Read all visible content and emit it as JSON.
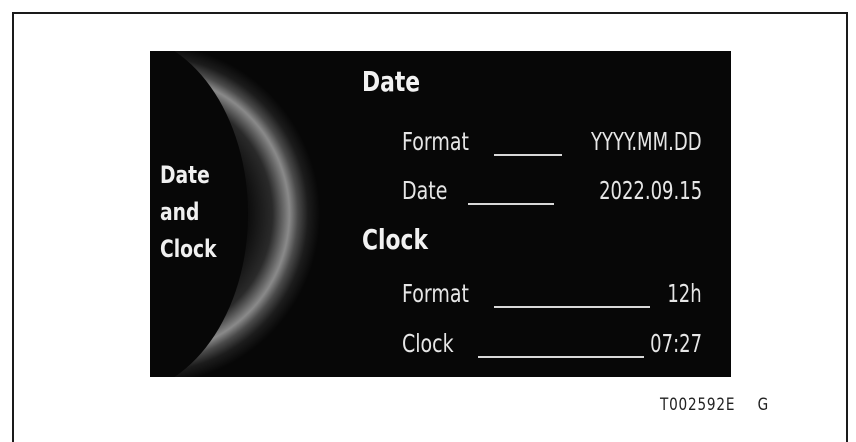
{
  "side_label": [
    "Date",
    "and",
    "Clock"
  ],
  "date_section": {
    "heading": "Date",
    "rows": [
      {
        "label": "Format",
        "value": "YYYY.MM.DD"
      },
      {
        "label": "Date",
        "value": "2022.09.15"
      }
    ]
  },
  "clock_section": {
    "heading": "Clock",
    "rows": [
      {
        "label": "Format",
        "value": "12h"
      },
      {
        "label": "Clock",
        "value": "07:27"
      }
    ]
  },
  "caption": {
    "code": "T002592E",
    "suffix": "G"
  },
  "colors": {
    "screen_bg": "#070707",
    "text": "#f0f0f0",
    "page_bg": "#ffffff"
  }
}
